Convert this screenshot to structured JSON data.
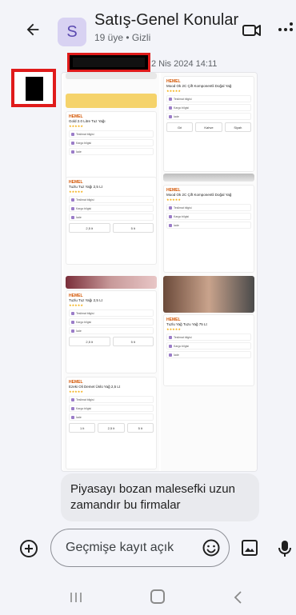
{
  "header": {
    "avatar_letter": "S",
    "title": "Satış-Genel Konular",
    "subtitle": "19 üye • Gizli"
  },
  "message": {
    "timestamp": "2 Nis 2024 14:11",
    "text": "Piyasayı bozan malesefki uzun zamandır bu firmalar"
  },
  "attachment": {
    "left_cards": [
      {
        "brand": "HEMEL",
        "title": "Gold 2.0 Litre Tuz Yağı",
        "rows": [
          "Teslimat bilgisi",
          "Kargo bilgisi",
          "İade"
        ],
        "options": []
      },
      {
        "brand": "HEMEL",
        "title": "Tuzlu Tuz Yağı 2,5 Lt",
        "rows": [
          "Teslimat bilgisi",
          "Kargo bilgisi",
          "İade"
        ],
        "options": [
          "2,5 lt",
          "5 lt"
        ]
      },
      {
        "brand": "HEMEL",
        "title": "Tuzlu Tuz Yağı 2,5 Lt",
        "rows": [
          "Teslimat bilgisi",
          "Kargo bilgisi",
          "İade"
        ],
        "options": [
          "2,5 lt",
          "5 lt"
        ]
      },
      {
        "brand": "HEMEL",
        "title": "Ezeki Oli Demet Ünlü Yağ 2,5 Lt",
        "rows": [
          "Teslimat bilgisi",
          "Kargo bilgisi",
          "İade"
        ],
        "options": [
          "1 lt",
          "2,5 lt",
          "5 lt"
        ]
      }
    ],
    "right_cards": [
      {
        "brand": "HEMEL",
        "title": "Mood Ok 2C Çift Komponentli Doğal Yağ",
        "rows": [
          "Teslimat bilgisi",
          "Kargo bilgisi",
          "İade"
        ],
        "options": [
          "Gri",
          "Kahve",
          "Siyah"
        ]
      },
      {
        "brand": "HEMEL",
        "title": "Mood Ok 2C Çift Komponentli Doğal Yağ",
        "rows": [
          "Teslimat bilgisi",
          "Kargo bilgisi",
          "İade"
        ],
        "options": []
      },
      {
        "brand": "HEMEL",
        "title": "Tuzlu Yağ Tuzu Yağ 75 Lt",
        "rows": [
          "Teslimat bilgisi",
          "Kargo bilgisi",
          "İade"
        ],
        "options": []
      }
    ]
  },
  "composer": {
    "placeholder": "Geçmişe kayıt açık"
  },
  "colors": {
    "background": "#f3f4f9",
    "bubble": "#e9eaee",
    "avatar_bg": "#d8d2f2",
    "redaction_border": "#e01b1b",
    "brand_orange": "#d35400"
  },
  "icons": [
    "back-arrow-icon",
    "video-call-icon",
    "more-vert-icon",
    "add-circle-icon",
    "emoji-icon",
    "image-icon",
    "mic-icon",
    "nav-recents-icon",
    "nav-home-icon",
    "nav-back-icon"
  ]
}
